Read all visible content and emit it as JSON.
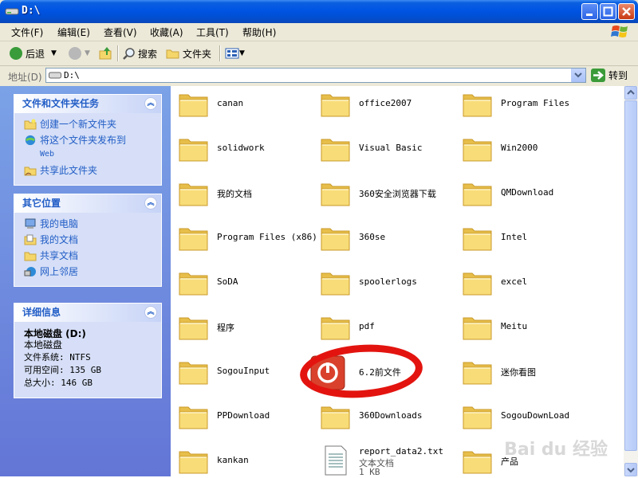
{
  "window": {
    "title": "D:\\",
    "title_icon": "drive-icon"
  },
  "menu": [
    "文件(F)",
    "编辑(E)",
    "查看(V)",
    "收藏(A)",
    "工具(T)",
    "帮助(H)"
  ],
  "toolbar": {
    "back_label": "后退",
    "search_label": "搜索",
    "folders_label": "文件夹"
  },
  "address": {
    "label": "地址(D)",
    "value": "D:\\",
    "go_label": "转到"
  },
  "sidebar": {
    "tasks": {
      "title": "文件和文件夹任务",
      "items": [
        {
          "label": "创建一个新文件夹",
          "icon": "new-folder-icon"
        },
        {
          "label": "将这个文件夹发布到",
          "sub": "Web",
          "icon": "publish-web-icon"
        },
        {
          "label": "共享此文件夹",
          "icon": "share-folder-icon"
        }
      ]
    },
    "places": {
      "title": "其它位置",
      "items": [
        {
          "label": "我的电脑",
          "icon": "my-computer-icon"
        },
        {
          "label": "我的文档",
          "icon": "my-documents-icon"
        },
        {
          "label": "共享文档",
          "icon": "shared-docs-icon"
        },
        {
          "label": "网上邻居",
          "icon": "network-icon"
        }
      ]
    },
    "details": {
      "title": "详细信息",
      "name": "本地磁盘 (D:)",
      "type": "本地磁盘",
      "fs": "文件系统: NTFS",
      "free": "可用空间: 135 GB",
      "total": "总大小: 146 GB"
    }
  },
  "items": [
    {
      "name": "canan",
      "type": "folder"
    },
    {
      "name": "office2007",
      "type": "folder"
    },
    {
      "name": "Program Files",
      "type": "folder"
    },
    {
      "name": "solidwork",
      "type": "folder"
    },
    {
      "name": "Visual Basic",
      "type": "folder"
    },
    {
      "name": "Win2000",
      "type": "folder"
    },
    {
      "name": "我的文档",
      "type": "folder"
    },
    {
      "name": "360安全浏览器下载",
      "type": "folder"
    },
    {
      "name": "QMDownload",
      "type": "folder"
    },
    {
      "name": "Program Files (x86)",
      "type": "folder"
    },
    {
      "name": "360se",
      "type": "folder"
    },
    {
      "name": "Intel",
      "type": "folder"
    },
    {
      "name": "SoDA",
      "type": "folder"
    },
    {
      "name": "spoolerlogs",
      "type": "folder"
    },
    {
      "name": "excel",
      "type": "folder"
    },
    {
      "name": "程序",
      "type": "folder"
    },
    {
      "name": "pdf",
      "type": "folder"
    },
    {
      "name": "Meitu",
      "type": "folder"
    },
    {
      "name": "SogouInput",
      "type": "folder"
    },
    {
      "name": "6.2前文件",
      "type": "locked"
    },
    {
      "name": "迷你看图",
      "type": "folder"
    },
    {
      "name": "PPDownload",
      "type": "folder"
    },
    {
      "name": "360Downloads",
      "type": "folder"
    },
    {
      "name": "SogouDownLoad",
      "type": "folder"
    },
    {
      "name": "kankan",
      "type": "folder"
    },
    {
      "name": "report_data2.txt",
      "type": "text",
      "subtype": "文本文档",
      "size": "1 KB"
    },
    {
      "name": "产品",
      "type": "folder"
    }
  ],
  "watermark": "Bai du 经验",
  "colors": {
    "title_blue": "#0054e3",
    "sidebar_blue": "#7ba2e7",
    "link_blue": "#215dc6",
    "folder_yellow": "#f5d66a",
    "highlight_red": "#e3140f"
  }
}
